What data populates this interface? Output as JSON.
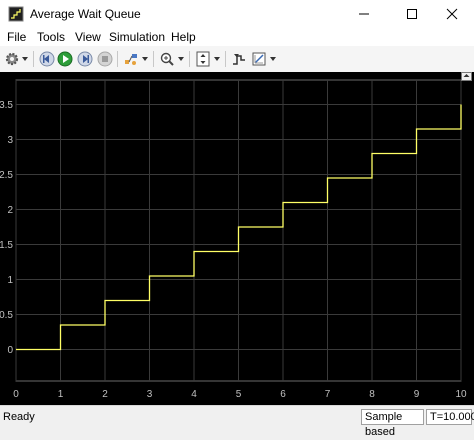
{
  "window": {
    "title": "Average Wait Queue"
  },
  "menu": {
    "items": [
      "File",
      "Tools",
      "View",
      "Simulation",
      "Help"
    ]
  },
  "toolbar": {
    "icons": [
      "settings-icon",
      "step-back-icon",
      "run-icon",
      "step-forward-icon",
      "stop-icon",
      "highlight-icon",
      "zoom-icon",
      "scale-axes-icon",
      "triggers-icon",
      "measurements-icon"
    ]
  },
  "colors": {
    "plot_bg": "#000000",
    "grid": "#3a3a3a",
    "trace": "#ffff66",
    "tick_text": "#c0c0c0"
  },
  "chart_data": {
    "type": "line",
    "step": true,
    "title": "",
    "xlabel": "",
    "ylabel": "",
    "xlim": [
      0,
      10
    ],
    "ylim": [
      -0.45,
      3.85
    ],
    "xticks": [
      "0",
      "1",
      "2",
      "3",
      "4",
      "5",
      "6",
      "7",
      "8",
      "9",
      "10"
    ],
    "yticks": [
      "0",
      "0.5",
      "1",
      "1.5",
      "2",
      "2.5",
      "3",
      "3.5"
    ],
    "grid": true,
    "series": [
      {
        "x": [
          0,
          1,
          1,
          2,
          2,
          3,
          3,
          4,
          4,
          5,
          5,
          6,
          6,
          7,
          7,
          8,
          8,
          9,
          9,
          10,
          10
        ],
        "y": [
          0,
          0,
          0.35,
          0.35,
          0.7,
          0.7,
          1.05,
          1.05,
          1.4,
          1.4,
          1.75,
          1.75,
          2.1,
          2.1,
          2.45,
          2.45,
          2.8,
          2.8,
          3.15,
          3.15,
          3.5
        ]
      }
    ]
  },
  "status": {
    "ready": "Ready",
    "mode": "Sample based",
    "time": "T=10.000"
  }
}
